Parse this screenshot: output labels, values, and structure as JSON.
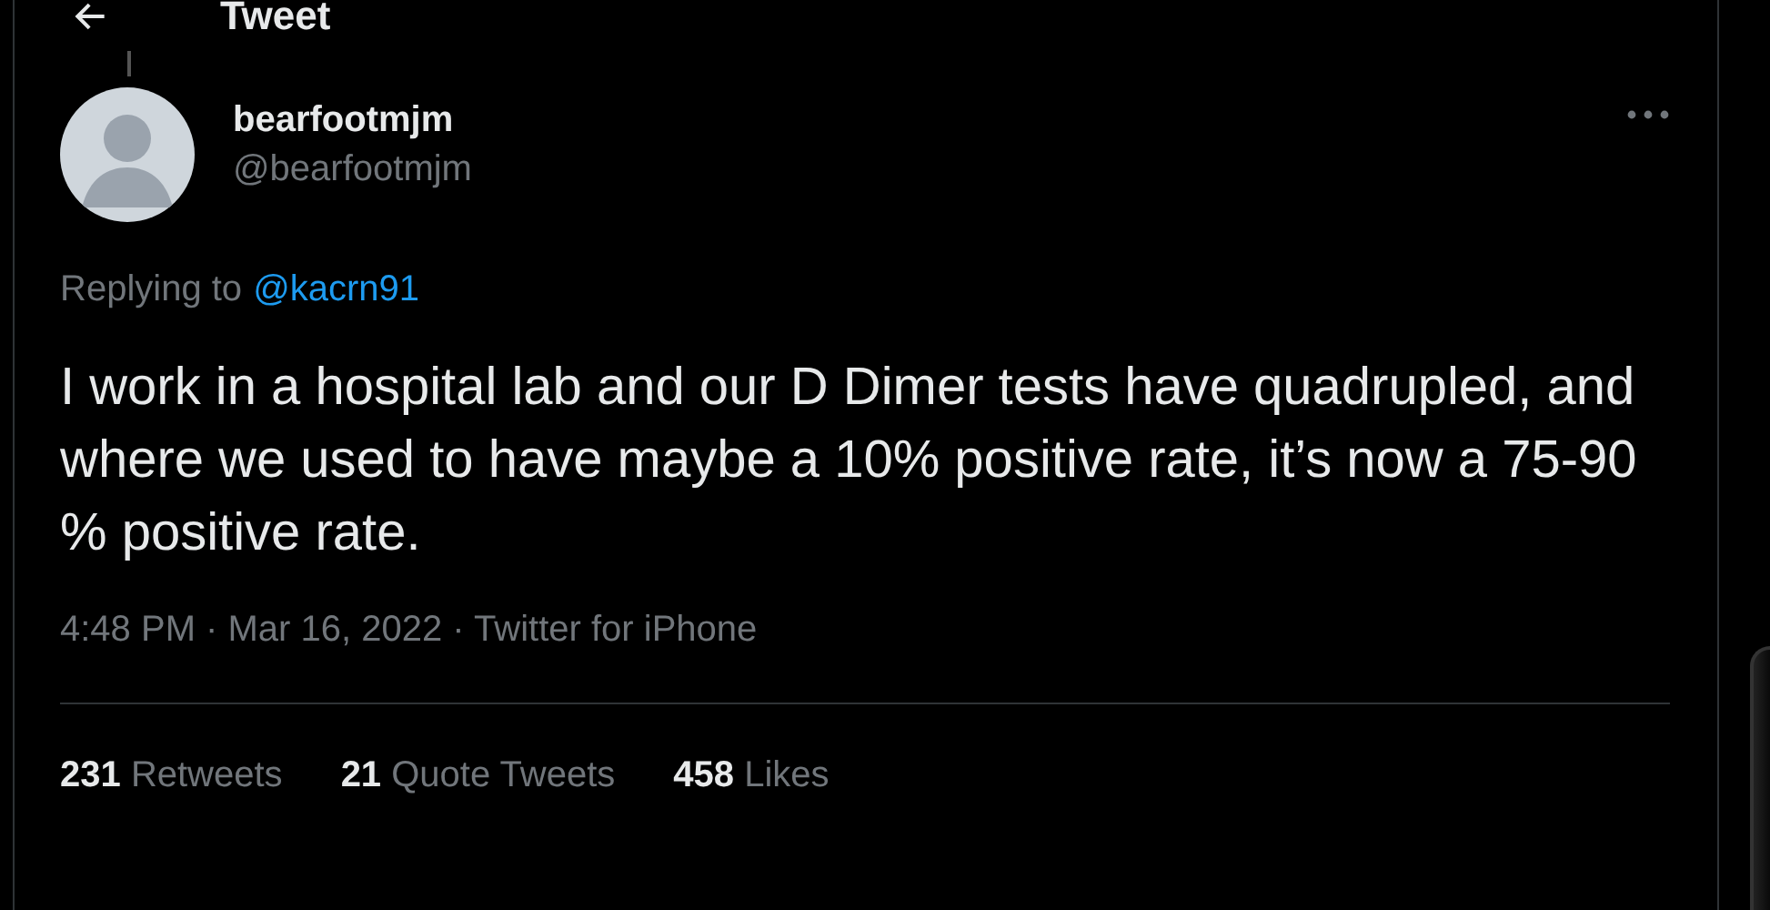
{
  "header": {
    "title": "Tweet"
  },
  "tweet": {
    "display_name": "bearfootmjm",
    "handle": "@bearfootmjm",
    "replying_label": "Replying to",
    "replying_to": "@kacrn91",
    "text": "I work in a hospital lab and our D Dimer tests have quadrupled, and where we used to have maybe a 10% positive rate, it’s now a 75-90 % positive rate.",
    "meta": "4:48 PM · Mar 16, 2022 · Twitter for iPhone"
  },
  "stats": [
    {
      "count": "231",
      "label": "Retweets"
    },
    {
      "count": "21",
      "label": "Quote Tweets"
    },
    {
      "count": "458",
      "label": "Likes"
    }
  ]
}
